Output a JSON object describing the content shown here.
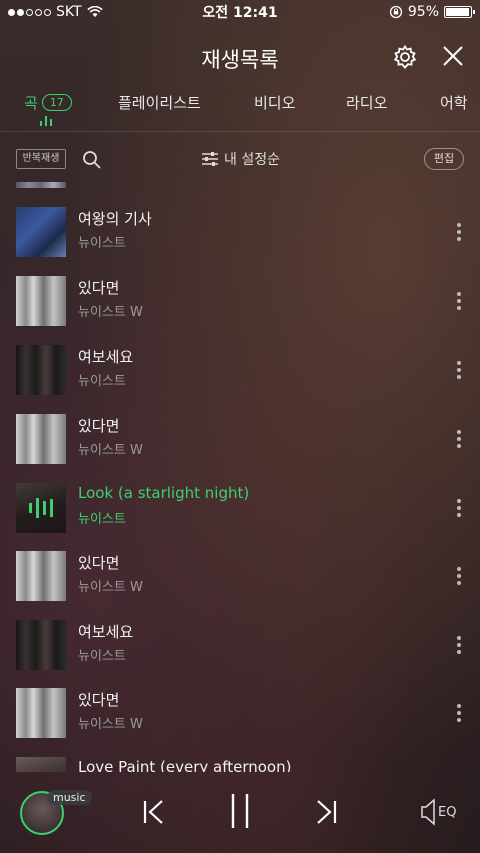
{
  "status": {
    "carrier": "SKT",
    "time": "오전 12:41",
    "battery": "95%",
    "battery_level": 0.95
  },
  "header": {
    "title": "재생목록",
    "settings_icon": "gear-icon",
    "close_icon": "close-icon"
  },
  "tabs": {
    "song": "곡",
    "song_count": "17",
    "playlist": "플레이리스트",
    "video": "비디오",
    "radio": "라디오",
    "language": "어학"
  },
  "toolbar": {
    "repeat_label": "반복재생",
    "sort_label": "내 설정순",
    "edit_label": "편집"
  },
  "songs": [
    {
      "title": "여왕의 기사",
      "artist": "뉴이스트",
      "playing": false
    },
    {
      "title": "있다면",
      "artist": "뉴이스트 W",
      "playing": false
    },
    {
      "title": "여보세요",
      "artist": "뉴이스트",
      "playing": false
    },
    {
      "title": "있다면",
      "artist": "뉴이스트 W",
      "playing": false
    },
    {
      "title": "Look (a starlight night)",
      "artist": "뉴이스트",
      "playing": true
    },
    {
      "title": "있다면",
      "artist": "뉴이스트 W",
      "playing": false
    },
    {
      "title": "여보세요",
      "artist": "뉴이스트",
      "playing": false
    },
    {
      "title": "있다면",
      "artist": "뉴이스트 W",
      "playing": false
    },
    {
      "title": "Love Paint (every afternoon)",
      "artist": "",
      "playing": false
    }
  ],
  "player": {
    "badge": "music",
    "eq_label": "EQ"
  },
  "colors": {
    "accent": "#3bd16f"
  }
}
